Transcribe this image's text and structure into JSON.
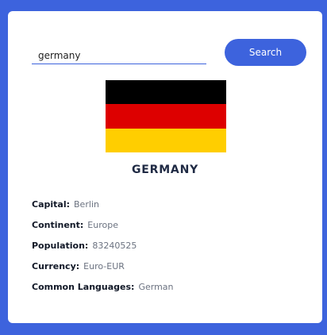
{
  "search": {
    "value": "germany",
    "placeholder": "",
    "button_label": "Search"
  },
  "flag": {
    "colors": [
      "#000000",
      "#dd0000",
      "#ffce00"
    ]
  },
  "country": {
    "name": "GERMANY"
  },
  "details": [
    {
      "label": "Capital:",
      "value": "Berlin"
    },
    {
      "label": "Continent:",
      "value": "Europe"
    },
    {
      "label": "Population:",
      "value": "83240525"
    },
    {
      "label": "Currency:",
      "value": "Euro-EUR"
    },
    {
      "label": "Common Languages:",
      "value": "German"
    }
  ],
  "colors": {
    "accent": "#3d63dd",
    "card": "#ffffff"
  }
}
